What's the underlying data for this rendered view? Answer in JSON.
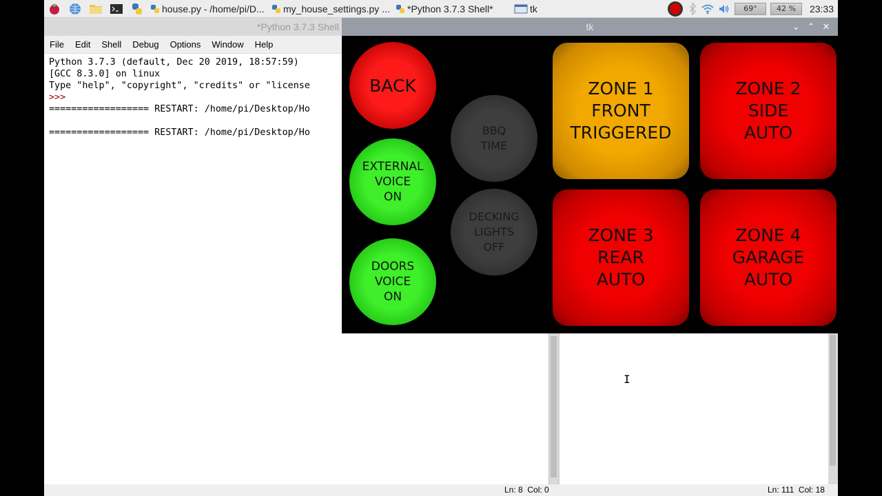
{
  "taskbar": {
    "tasks": [
      {
        "label": "house.py - /home/pi/D..."
      },
      {
        "label": "my_house_settings.py ..."
      },
      {
        "label": "*Python 3.7.3 Shell*"
      },
      {
        "label": "tk"
      }
    ],
    "temperature": "69°",
    "cpu": "42 %",
    "clock": "23:33"
  },
  "shell": {
    "title": "*Python 3.7.3 Shell",
    "menu": [
      "File",
      "Edit",
      "Shell",
      "Debug",
      "Options",
      "Window",
      "Help"
    ],
    "lines": [
      "Python 3.7.3 (default, Dec 20 2019, 18:57:59)",
      "[GCC 8.3.0] on linux",
      "Type \"help\", \"copyright\", \"credits\" or \"license"
    ],
    "prompt": ">>>",
    "restart1": "================== RESTART: /home/pi/Desktop/Ho",
    "restart2": "================== RESTART: /home/pi/Desktop/Ho"
  },
  "status": {
    "left": "Ln: 8  Col: 0",
    "right": "Ln: 111  Col: 18"
  },
  "tk": {
    "title": "tk",
    "buttons": {
      "back": "BACK",
      "external_voice": "EXTERNAL\nVOICE\nON",
      "doors_voice": "DOORS\nVOICE\nON",
      "bbq": "BBQ\nTIME",
      "decking": "DECKING\nLIGHTS\nOFF"
    },
    "zones": [
      {
        "label": "ZONE 1\nFRONT\nTRIGGERED",
        "state": "triggered",
        "color": "#f2a800"
      },
      {
        "label": "ZONE 2\nSIDE\nAUTO",
        "state": "auto",
        "color": "#f00000"
      },
      {
        "label": "ZONE 3\nREAR\nAUTO",
        "state": "auto",
        "color": "#f00000"
      },
      {
        "label": "ZONE 4\nGARAGE\nAUTO",
        "state": "auto",
        "color": "#f00000"
      }
    ]
  }
}
